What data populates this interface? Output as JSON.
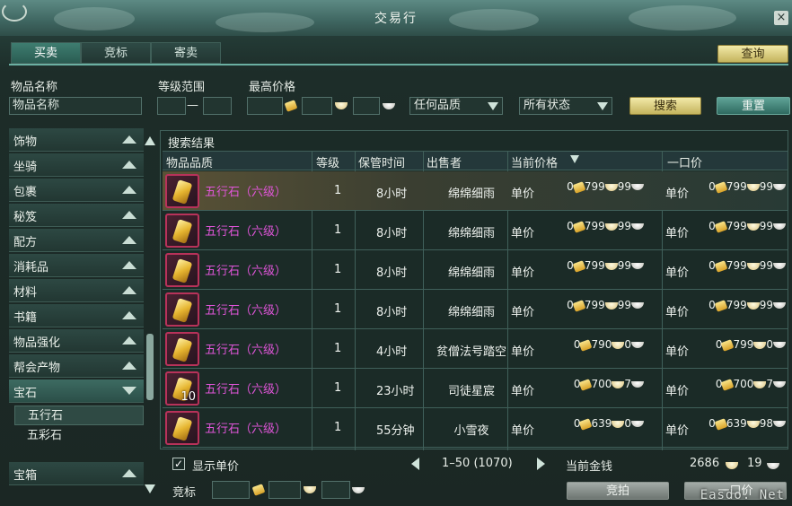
{
  "window": {
    "title": "交易行",
    "close_label": "×"
  },
  "tabs": [
    {
      "label": "买卖"
    },
    {
      "label": "竞标"
    },
    {
      "label": "寄卖"
    }
  ],
  "query_button": "查询",
  "filters": {
    "item_name_label": "物品名称",
    "item_name_value": "物品名称",
    "level_range_label": "等级范围",
    "level_dash": "—",
    "max_price_label": "最高价格",
    "quality_select": "任何品质",
    "status_select": "所有状态",
    "search_button": "搜索",
    "reset_button": "重置"
  },
  "sidebar": {
    "items": [
      {
        "label": "饰物"
      },
      {
        "label": "坐骑"
      },
      {
        "label": "包裹"
      },
      {
        "label": "秘笈"
      },
      {
        "label": "配方"
      },
      {
        "label": "消耗品"
      },
      {
        "label": "材料"
      },
      {
        "label": "书籍"
      },
      {
        "label": "物品强化"
      },
      {
        "label": "帮会产物"
      },
      {
        "label": "宝石"
      }
    ],
    "sub_items": [
      {
        "label": "五行石"
      },
      {
        "label": "五彩石"
      }
    ],
    "last_item": {
      "label": "宝箱"
    }
  },
  "results": {
    "title": "搜索结果",
    "columns": {
      "quality": "物品品质",
      "level": "等级",
      "time": "保管时间",
      "seller": "出售者",
      "current_price": "当前价格",
      "buyout": "一口价"
    },
    "unit_label": "单价",
    "rows": [
      {
        "name": "五行石（六级）",
        "qty": "",
        "level": "1",
        "time": "8小时",
        "seller": "绵绵细雨",
        "cur": {
          "g": "0",
          "s": "799",
          "c": "99"
        },
        "buy": {
          "g": "0",
          "s": "799",
          "c": "99"
        }
      },
      {
        "name": "五行石（六级）",
        "qty": "",
        "level": "1",
        "time": "8小时",
        "seller": "绵绵细雨",
        "cur": {
          "g": "0",
          "s": "799",
          "c": "99"
        },
        "buy": {
          "g": "0",
          "s": "799",
          "c": "99"
        }
      },
      {
        "name": "五行石（六级）",
        "qty": "",
        "level": "1",
        "time": "8小时",
        "seller": "绵绵细雨",
        "cur": {
          "g": "0",
          "s": "799",
          "c": "99"
        },
        "buy": {
          "g": "0",
          "s": "799",
          "c": "99"
        }
      },
      {
        "name": "五行石（六级）",
        "qty": "",
        "level": "1",
        "time": "8小时",
        "seller": "绵绵细雨",
        "cur": {
          "g": "0",
          "s": "799",
          "c": "99"
        },
        "buy": {
          "g": "0",
          "s": "799",
          "c": "99"
        }
      },
      {
        "name": "五行石（六级）",
        "qty": "",
        "level": "1",
        "time": "4小时",
        "seller": "贫僧法号踏空",
        "cur": {
          "g": "0",
          "s": "790",
          "c": "0"
        },
        "buy": {
          "g": "0",
          "s": "799",
          "c": "0"
        }
      },
      {
        "name": "五行石（六级）",
        "qty": "10",
        "level": "1",
        "time": "23小时",
        "seller": "司徒星宸",
        "cur": {
          "g": "0",
          "s": "700",
          "c": "7"
        },
        "buy": {
          "g": "0",
          "s": "700",
          "c": "7"
        }
      },
      {
        "name": "五行石（六级）",
        "qty": "",
        "level": "1",
        "time": "55分钟",
        "seller": "小雪夜",
        "cur": {
          "g": "0",
          "s": "639",
          "c": "0"
        },
        "buy": {
          "g": "0",
          "s": "639",
          "c": "98"
        }
      }
    ]
  },
  "footer": {
    "show_unit_price_label": "显示单价",
    "checkbox_mark": "✓",
    "pagination": "1–50 (1070)",
    "current_money_label": "当前金钱",
    "money_silver": "2686",
    "money_copper": "19",
    "bid_label": "竞标",
    "bid_button": "竞拍",
    "buyout_button": "一口价"
  },
  "watermark": "Easdo. Net"
}
